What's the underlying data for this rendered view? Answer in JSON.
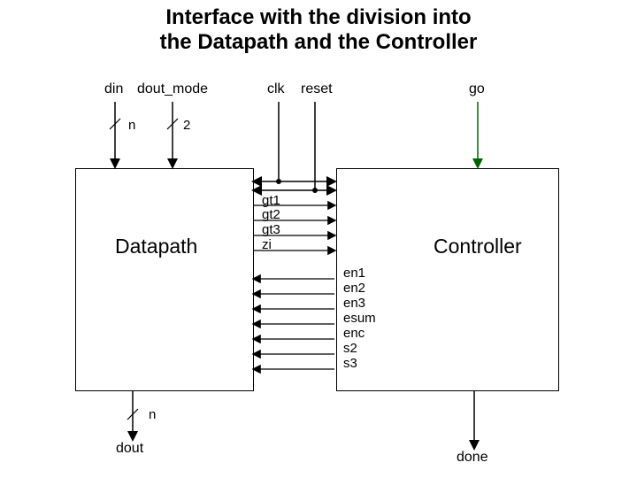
{
  "title": {
    "line1": "Interface with the division into",
    "line2": "the Datapath and the Controller"
  },
  "blocks": {
    "datapath": "Datapath",
    "controller": "Controller"
  },
  "inputs": {
    "din": "din",
    "dout_mode": "dout_mode",
    "clk": "clk",
    "reset": "reset",
    "go": "go"
  },
  "bus_widths": {
    "din": "n",
    "dout_mode": "2",
    "dout": "n"
  },
  "outputs": {
    "dout": "dout",
    "done": "done"
  },
  "signals_dp_to_ctrl": [
    "gt1",
    "gt2",
    "gt3",
    "zi"
  ],
  "signals_ctrl_to_dp": [
    "en1",
    "en2",
    "en3",
    "esum",
    "enc",
    "s2",
    "s3"
  ],
  "chart_data": {
    "type": "diagram",
    "blocks": [
      {
        "name": "Datapath",
        "kind": "functional"
      },
      {
        "name": "Controller",
        "kind": "functional"
      }
    ],
    "external_inputs": [
      {
        "name": "din",
        "target": "Datapath",
        "width": "n"
      },
      {
        "name": "dout_mode",
        "target": "Datapath",
        "width": "2"
      },
      {
        "name": "clk",
        "target": [
          "Datapath",
          "Controller"
        ]
      },
      {
        "name": "reset",
        "target": [
          "Datapath",
          "Controller"
        ]
      },
      {
        "name": "go",
        "target": "Controller"
      }
    ],
    "external_outputs": [
      {
        "name": "dout",
        "source": "Datapath",
        "width": "n"
      },
      {
        "name": "done",
        "source": "Controller"
      }
    ],
    "internal_signals": {
      "datapath_to_controller": [
        "gt1",
        "gt2",
        "gt3",
        "zi"
      ],
      "controller_to_datapath": [
        "en1",
        "en2",
        "en3",
        "esum",
        "enc",
        "s2",
        "s3"
      ]
    }
  }
}
